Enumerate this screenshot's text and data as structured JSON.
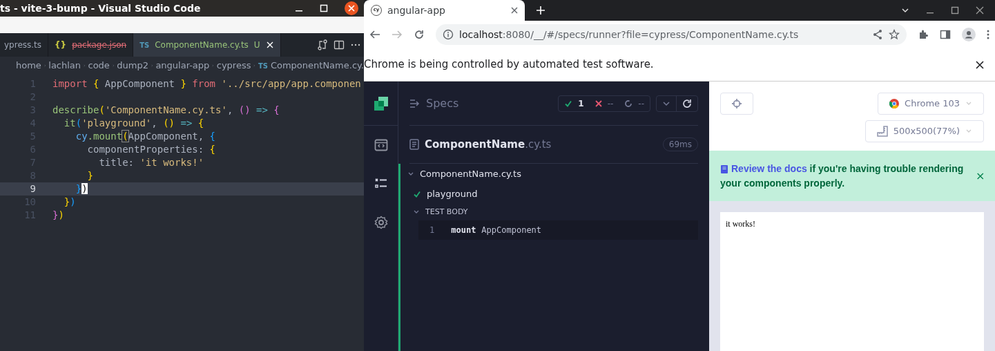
{
  "vscode": {
    "title": "ts - vite-3-bump - Visual Studio Code",
    "tabs": [
      {
        "label": "ypress.ts",
        "selected": false,
        "deleted": false
      },
      {
        "icon_text": "{}",
        "label": "package.json",
        "selected": false,
        "deleted": true
      },
      {
        "icon_text": "TS",
        "label": "ComponentName.cy.ts",
        "status": "U",
        "selected": true,
        "deleted": false
      }
    ],
    "breadcrumb": [
      {
        "label": "home"
      },
      {
        "label": "lachlan"
      },
      {
        "label": "code"
      },
      {
        "label": "dump2"
      },
      {
        "label": "angular-app"
      },
      {
        "label": "cypress"
      },
      {
        "icon_text": "TS",
        "label": "ComponentName.cy."
      }
    ],
    "lines": [
      {
        "number": "1",
        "selected": false,
        "tokens": [
          {
            "text": "import",
            "kind": "keyword"
          },
          {
            "text": " {",
            "kind": "brace1"
          },
          {
            "text": " AppComponent ",
            "kind": "plain"
          },
          {
            "text": "}",
            "kind": "brace1"
          },
          {
            "text": " from ",
            "kind": "keyword"
          },
          {
            "text": "'../src/app/app.componen",
            "kind": "string"
          }
        ]
      },
      {
        "number": "2",
        "selected": false
      },
      {
        "number": "3",
        "selected": false,
        "tokens": [
          {
            "text": "describe",
            "kind": "function"
          },
          {
            "text": "(",
            "kind": "brace1"
          },
          {
            "text": "'ComponentName.cy.ts'",
            "kind": "string"
          },
          {
            "text": ", ",
            "kind": "plain"
          },
          {
            "text": "()",
            "kind": "brace2"
          },
          {
            "text": " => ",
            "kind": "operator"
          },
          {
            "text": "{",
            "kind": "brace2"
          }
        ]
      },
      {
        "number": "4",
        "selected": false,
        "tokens": [
          {
            "text": "  it",
            "kind": "function"
          },
          {
            "text": "(",
            "kind": "brace3"
          },
          {
            "text": "'playground'",
            "kind": "string"
          },
          {
            "text": ", ",
            "kind": "plain"
          },
          {
            "text": "()",
            "kind": "brace1"
          },
          {
            "text": " => ",
            "kind": "operator"
          },
          {
            "text": "{",
            "kind": "brace1"
          }
        ]
      },
      {
        "number": "5",
        "selected": false,
        "tokens": [
          {
            "text": "    cy",
            "kind": "object"
          },
          {
            "text": ".mount",
            "kind": "function"
          },
          {
            "text": "(",
            "kind": "match"
          },
          {
            "text": "AppComponent, ",
            "kind": "plain"
          },
          {
            "text": "{",
            "kind": "brace3"
          }
        ]
      },
      {
        "number": "6",
        "selected": false,
        "tokens": [
          {
            "text": "      componentProperties: ",
            "kind": "plain"
          },
          {
            "text": "{",
            "kind": "brace1"
          }
        ]
      },
      {
        "number": "7",
        "selected": false,
        "tokens": [
          {
            "text": "        title: ",
            "kind": "plain"
          },
          {
            "text": "'it works!'",
            "kind": "string"
          }
        ]
      },
      {
        "number": "8",
        "selected": false,
        "tokens": [
          {
            "text": "      }",
            "kind": "brace1"
          }
        ]
      },
      {
        "number": "9",
        "selected": true,
        "tokens": [
          {
            "text": "    }",
            "kind": "brace3"
          },
          {
            "text": ")",
            "kind": "cursor"
          }
        ]
      },
      {
        "number": "10",
        "selected": false,
        "tokens": [
          {
            "text": "  }",
            "kind": "brace1"
          },
          {
            "text": ")",
            "kind": "brace3"
          }
        ]
      },
      {
        "number": "11",
        "selected": false,
        "tokens": [
          {
            "text": "}",
            "kind": "brace2"
          },
          {
            "text": ")",
            "kind": "brace1"
          }
        ]
      }
    ]
  },
  "chrome": {
    "tab": {
      "favicon_text": "cy",
      "title": "angular-app"
    },
    "address": {
      "host": "localhost",
      "path": ":8080/__/#/specs/runner?file=cypress/ComponentName.cy.ts"
    },
    "infobar": "Chrome is being controlled by automated test software."
  },
  "cypress": {
    "nav": [
      {
        "selected": false
      },
      {
        "selected": true
      },
      {
        "selected": false
      }
    ],
    "specs_title": "Specs",
    "stats": {
      "passed": "1",
      "failed": "--",
      "pending": "--"
    },
    "spec": {
      "name": "ComponentName",
      "extension": ".cy.ts",
      "duration": "69ms"
    },
    "suite": "ComponentName.cy.ts",
    "test": {
      "title": "playground",
      "passed": true
    },
    "section": "TEST BODY",
    "commands": [
      {
        "number": "1",
        "name": "mount",
        "message": "AppComponent"
      }
    ],
    "browser": "Chrome 103",
    "viewport": {
      "size": "500x500",
      "scale": "(77%)"
    },
    "alert": {
      "link": "Review the docs",
      "text": " if you're having trouble rendering your components properly."
    },
    "app_text": "it works!"
  }
}
